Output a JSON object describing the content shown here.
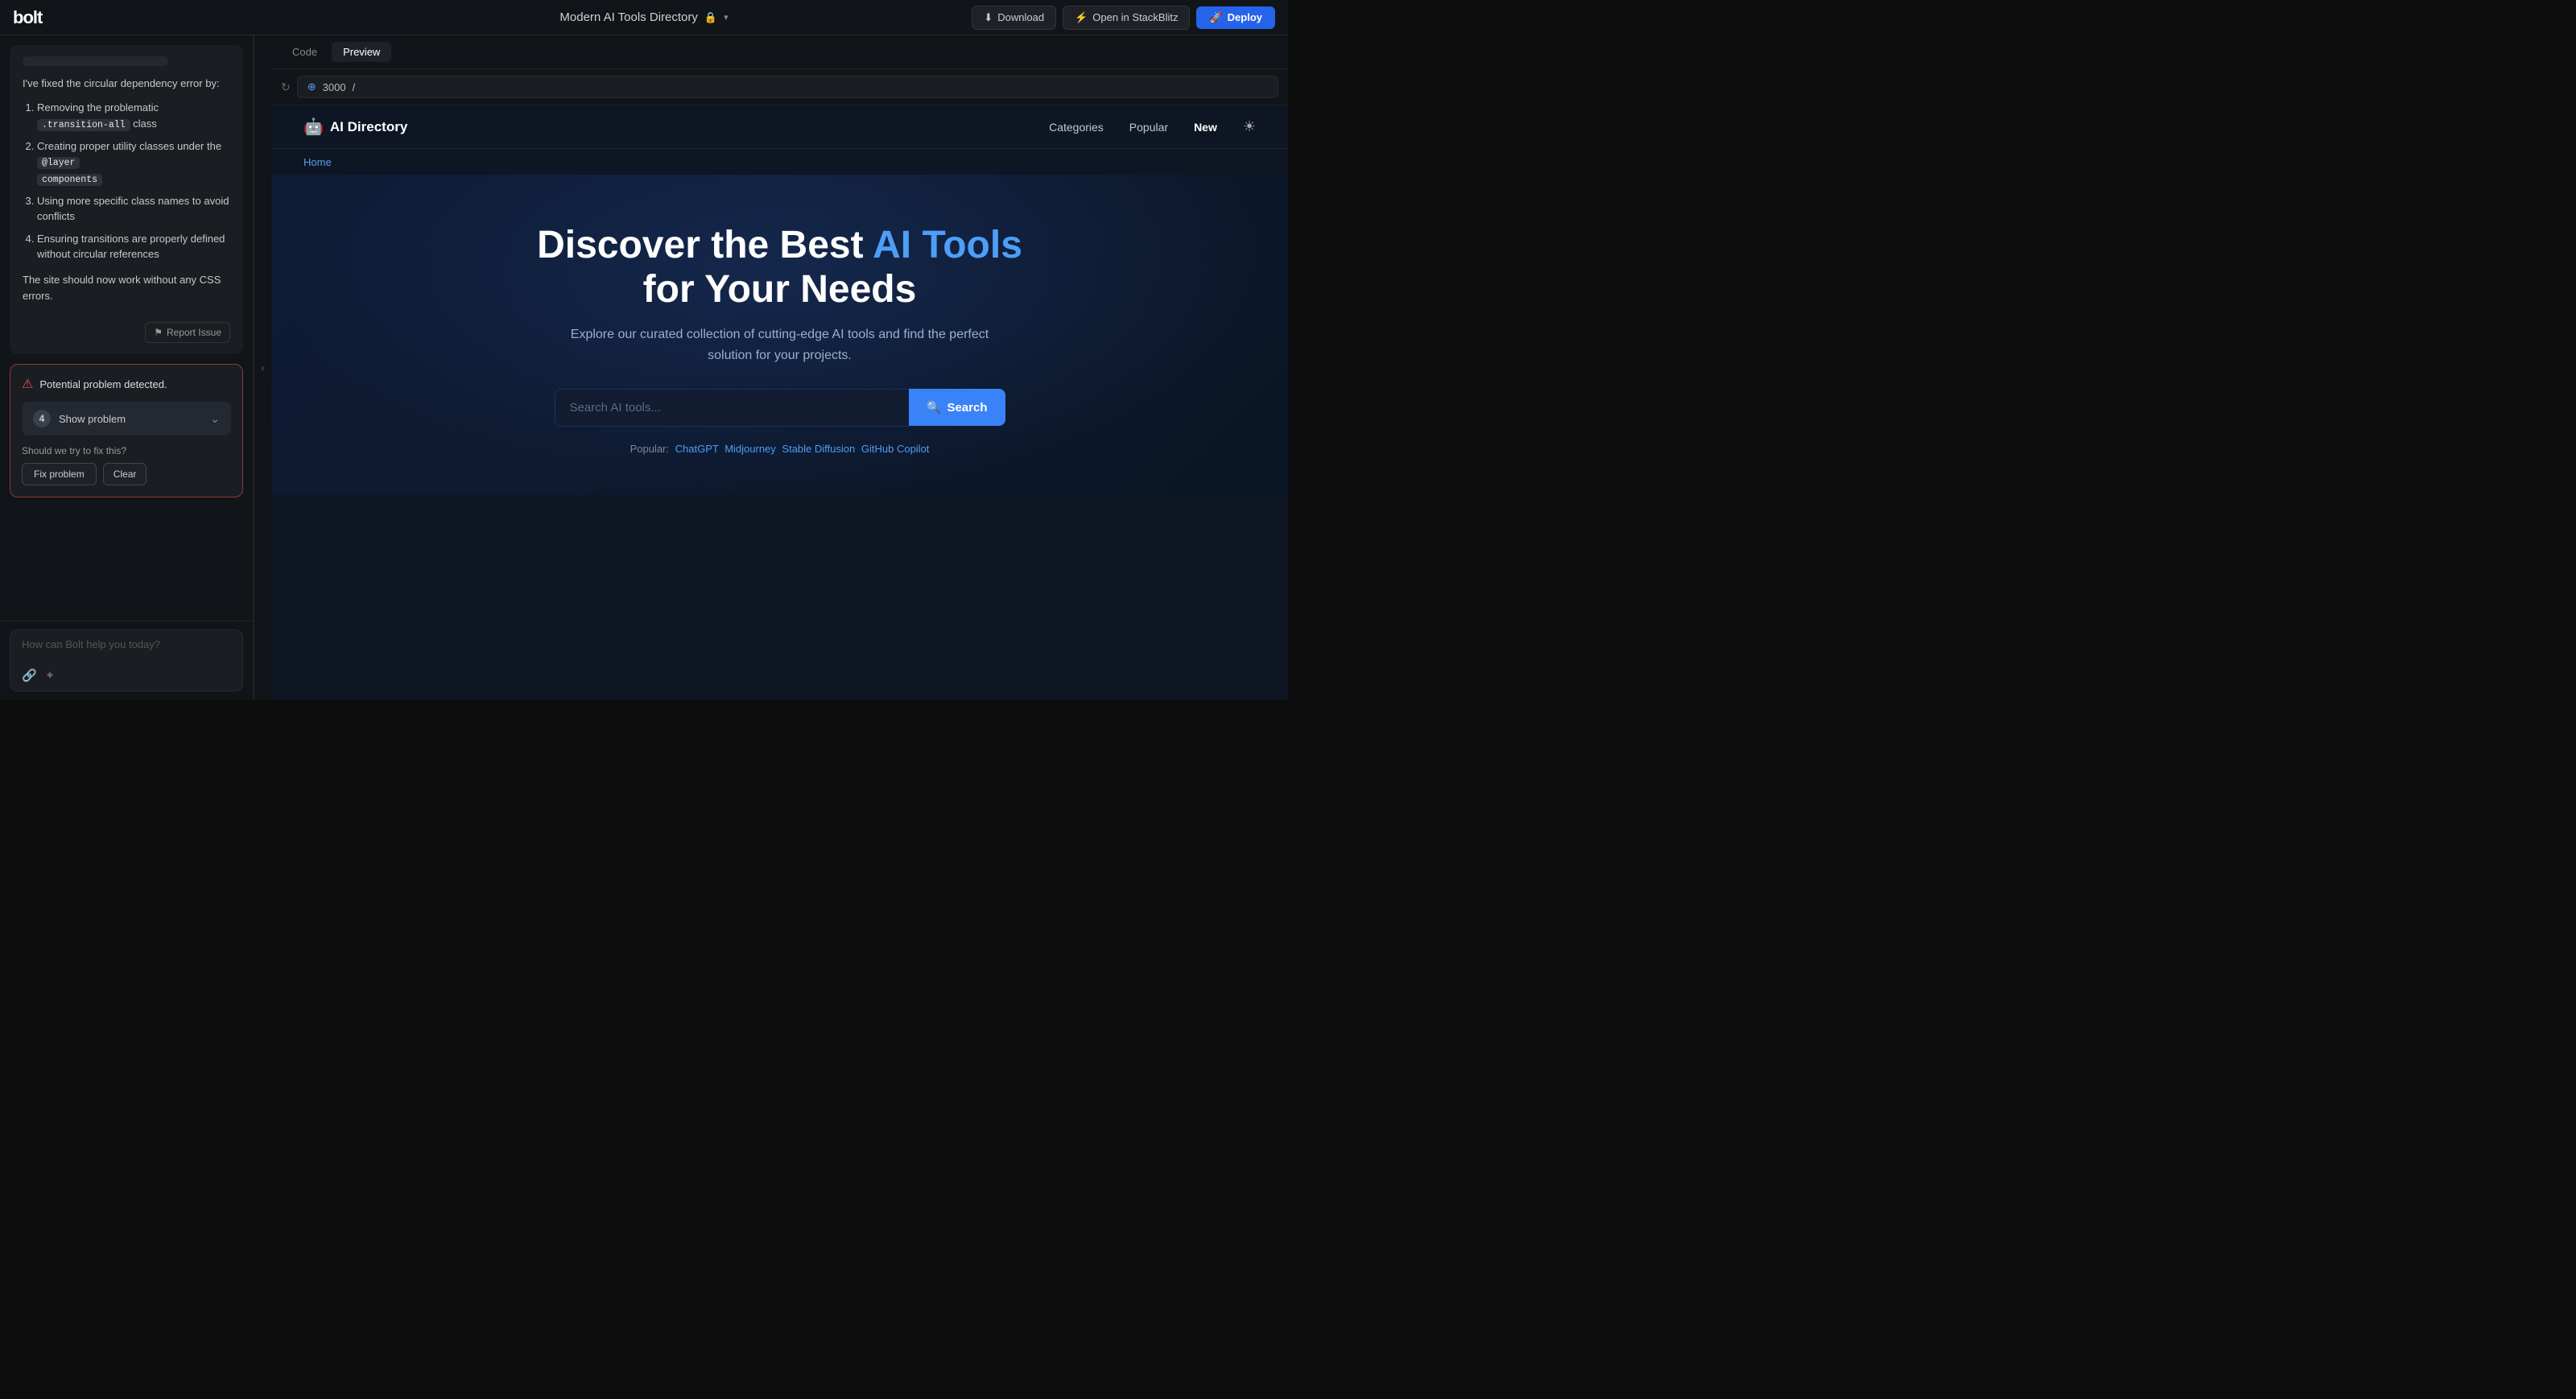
{
  "topbar": {
    "logo": "bolt",
    "title": "Modern AI Tools Directory",
    "lock_icon": "🔒",
    "chevron_icon": "▾",
    "download_label": "Download",
    "stackblitz_label": "Open in StackBlitz",
    "deploy_label": "Deploy"
  },
  "chat": {
    "fix_message": {
      "header_text": "I've fixed the circular dependency error by:",
      "items": [
        {
          "text": "Removing the problematic ",
          "code": ".transition-all",
          "after": " class"
        },
        {
          "text": "Creating proper utility classes under the ",
          "code": "@layer",
          "code2": "components",
          "after": ""
        },
        {
          "text": "Using more specific class names to avoid conflicts",
          "code": null
        },
        {
          "text": "Ensuring transitions are properly defined without circular references",
          "code": null
        }
      ],
      "footer": "The site should now work without any CSS errors.",
      "report_btn": "Report Issue"
    },
    "problem_box": {
      "header": "Potential problem detected.",
      "count": "4",
      "show_problem_label": "Show problem",
      "should_fix": "Should we try to fix this?",
      "fix_btn": "Fix problem",
      "clear_btn": "Clear"
    },
    "input_placeholder": "How can Bolt help you today?"
  },
  "preview": {
    "tab_code": "Code",
    "tab_preview": "Preview",
    "url_port": "3000",
    "url_path": "/"
  },
  "ai_app": {
    "nav": {
      "logo_icon": "🤖",
      "logo_text": "AI Directory",
      "links": [
        "Categories",
        "Popular",
        "New"
      ],
      "sun_icon": "☀"
    },
    "breadcrumb": "Home",
    "hero": {
      "title_start": "Discover the Best ",
      "title_blue": "AI Tools",
      "title_end": " for Your Needs",
      "subtitle": "Explore our curated collection of cutting-edge AI tools and find the perfect solution for your projects.",
      "search_placeholder": "Search AI tools...",
      "search_btn": "Search",
      "popular_label": "Popular:",
      "popular_links": [
        "ChatGPT",
        "Midjourney",
        "Stable Diffusion",
        "GitHub Copilot"
      ]
    }
  }
}
